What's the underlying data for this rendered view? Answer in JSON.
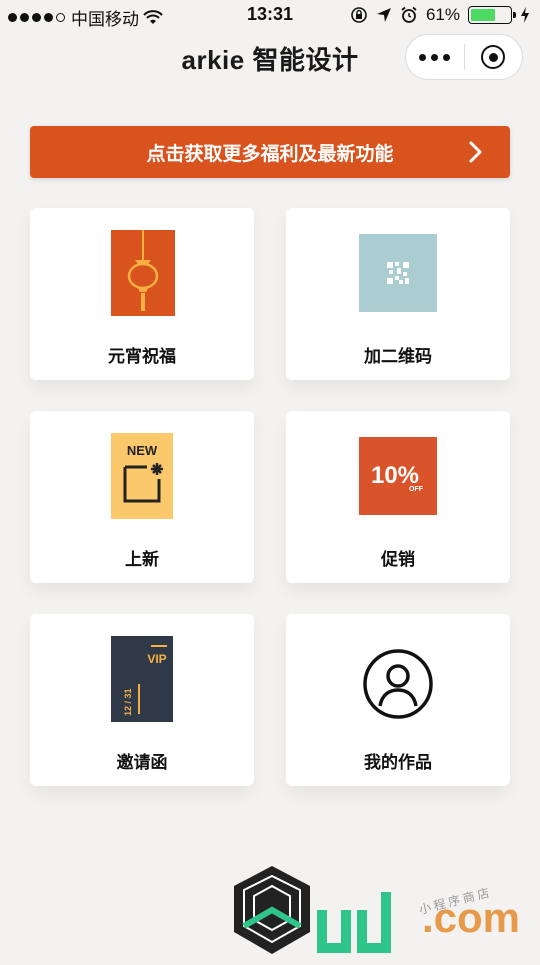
{
  "status_bar": {
    "carrier": "中国移动",
    "time": "13:31",
    "battery": "61%"
  },
  "header": {
    "title": "arkie 智能设计"
  },
  "banner": {
    "text": "点击获取更多福利及最新功能"
  },
  "cards": [
    {
      "label": "元宵祝福",
      "icon": "lantern-icon"
    },
    {
      "label": "加二维码",
      "icon": "qr-code-icon"
    },
    {
      "label": "上新",
      "icon": "new-icon"
    },
    {
      "label": "促销",
      "icon": "discount-icon"
    },
    {
      "label": "邀请函",
      "icon": "vip-invitation-icon"
    },
    {
      "label": "我的作品",
      "icon": "user-icon"
    }
  ],
  "icon_text": {
    "new": "NEW",
    "percent": "10%",
    "off": "OFF",
    "vip": "VIP",
    "date": "12 / 31"
  },
  "colors": {
    "accent": "#d9531e",
    "qr_bg": "#a9cdd1",
    "new_bg": "#fbc86b",
    "vip_bg": "#2f3947",
    "vip_text": "#f6b042",
    "battery": "#4cd964"
  },
  "watermark": {
    "brand": ".com",
    "tagline": "小程序商店"
  }
}
